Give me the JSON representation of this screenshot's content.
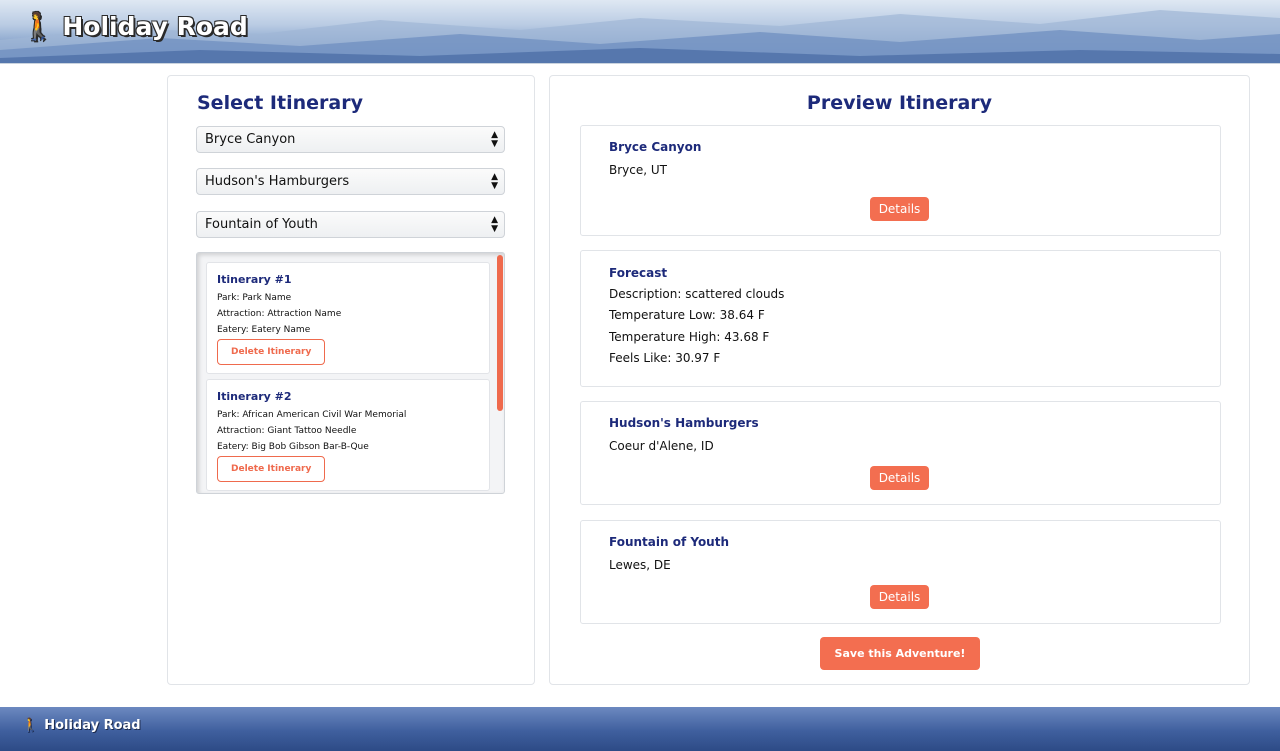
{
  "header": {
    "brand": "Holiday Road",
    "brand_icon": "hiker-icon"
  },
  "left_panel": {
    "title": "Select Itinerary",
    "selects": [
      {
        "selected": "Bryce Canyon"
      },
      {
        "selected": "Hudson's Hamburgers"
      },
      {
        "selected": "Fountain of Youth"
      }
    ],
    "saved_itineraries": [
      {
        "title": "Itinerary #1",
        "park": "Park: Park Name",
        "attraction": "Attraction: Attraction Name",
        "eatery": "Eatery: Eatery Name",
        "delete_label": "Delete Itinerary"
      },
      {
        "title": "Itinerary #2",
        "park": "Park: African American Civil War Memorial",
        "attraction": "Attraction: Giant Tattoo Needle",
        "eatery": "Eatery: Big Bob Gibson Bar-B-Que",
        "delete_label": "Delete Itinerary"
      }
    ]
  },
  "right_panel": {
    "title": "Preview Itinerary",
    "park": {
      "name": "Bryce Canyon",
      "location": "Bryce, UT",
      "details_label": "Details"
    },
    "forecast": {
      "title": "Forecast",
      "description": "Description: scattered clouds",
      "temp_low": "Temperature Low: 38.64 F",
      "temp_high": "Temperature High: 43.68 F",
      "feels_like": "Feels Like: 30.97 F"
    },
    "eatery": {
      "name": "Hudson's Hamburgers",
      "location": "Coeur d'Alene, ID",
      "details_label": "Details"
    },
    "attraction": {
      "name": "Fountain of Youth",
      "location": "Lewes, DE",
      "details_label": "Details"
    },
    "save_label": "Save this Adventure!"
  },
  "footer": {
    "brand": "Holiday Road"
  },
  "colors": {
    "accent": "#f36e50",
    "title_blue": "#1d2a7a",
    "footer_blue": "#3f5f9e"
  }
}
